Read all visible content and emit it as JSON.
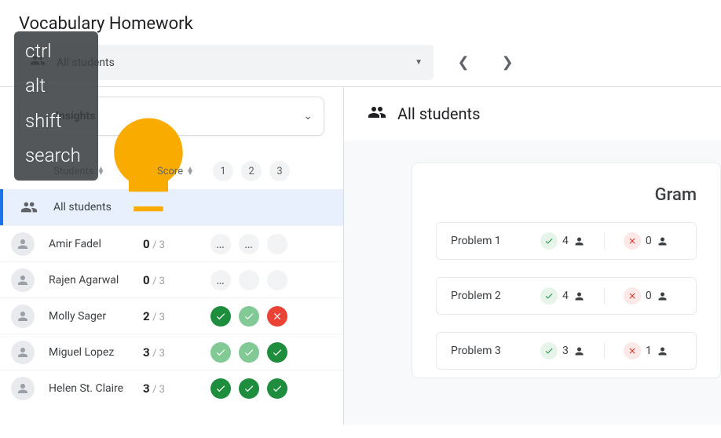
{
  "title": "Vocabulary Homework",
  "filter": {
    "label": "All students"
  },
  "insights": {
    "label": "Insights"
  },
  "columns": {
    "students": "Students",
    "score": "Score",
    "problems": [
      "1",
      "2",
      "3"
    ]
  },
  "rows": {
    "all": {
      "name": "All students"
    },
    "list": [
      {
        "name": "Amir Fadel",
        "earned": "0",
        "total": "/ 3",
        "status": [
          "dots",
          "dots",
          "empty"
        ]
      },
      {
        "name": "Rajen Agarwal",
        "earned": "0",
        "total": "/ 3",
        "status": [
          "dots",
          "empty",
          "empty"
        ]
      },
      {
        "name": "Molly Sager",
        "earned": "2",
        "total": "/ 3",
        "status": [
          "correct",
          "correct-light",
          "wrong"
        ]
      },
      {
        "name": "Miguel Lopez",
        "earned": "3",
        "total": "/ 3",
        "status": [
          "correct-light",
          "correct-light",
          "correct"
        ]
      },
      {
        "name": "Helen St. Claire",
        "earned": "3",
        "total": "/ 3",
        "status": [
          "correct",
          "correct",
          "correct"
        ]
      }
    ]
  },
  "right": {
    "title": "All students",
    "card_title": "Gram",
    "problems": [
      {
        "label": "Problem 1",
        "correct": "4",
        "wrong": "0"
      },
      {
        "label": "Problem 2",
        "correct": "4",
        "wrong": "0"
      },
      {
        "label": "Problem 3",
        "correct": "3",
        "wrong": "1"
      }
    ]
  },
  "kbd": {
    "ctrl": "ctrl",
    "alt": "alt",
    "shift": "shift",
    "search": "search"
  }
}
